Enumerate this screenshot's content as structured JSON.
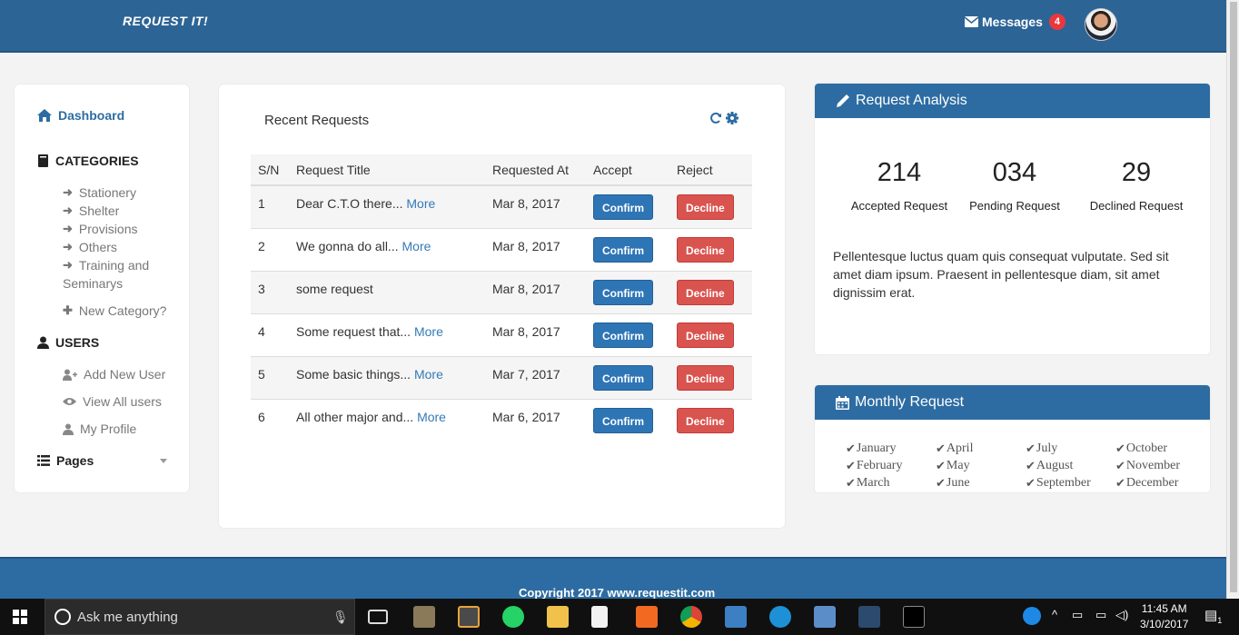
{
  "header": {
    "brand": "REQUEST IT!",
    "messages_label": "Messages",
    "messages_count": "4"
  },
  "sidebar": {
    "dashboard": "Dashboard",
    "categories_title": "CATEGORIES",
    "categories": [
      "Stationery",
      "Shelter",
      "Provisions",
      "Others",
      "Training and",
      "Seminarys"
    ],
    "new_category": "New Category?",
    "users_title": "USERS",
    "add_user": "Add New User",
    "view_users": "View All users",
    "my_profile": "My Profile",
    "pages": "Pages"
  },
  "main": {
    "title": "Recent Requests",
    "columns": [
      "S/N",
      "Request Title",
      "Requested At",
      "Accept",
      "Reject"
    ],
    "confirm_label": "Confirm",
    "decline_label": "Decline",
    "rows": [
      {
        "sn": "1",
        "title": "Dear C.T.O there...",
        "more": "More",
        "date": "Mar 8, 2017"
      },
      {
        "sn": "2",
        "title": "We gonna do all...",
        "more": "More",
        "date": "Mar 8, 2017"
      },
      {
        "sn": "3",
        "title": "some request",
        "more": "",
        "date": "Mar 8, 2017"
      },
      {
        "sn": "4",
        "title": "Some request that...",
        "more": "More",
        "date": "Mar 8, 2017"
      },
      {
        "sn": "5",
        "title": "Some basic things...",
        "more": "More",
        "date": "Mar 7, 2017"
      },
      {
        "sn": "6",
        "title": "All other major and...",
        "more": "More",
        "date": "Mar 6, 2017"
      }
    ]
  },
  "analysis": {
    "title": "Request Analysis",
    "accepted_value": "214",
    "accepted_label": "Accepted Request",
    "pending_value": "034",
    "pending_label": "Pending Request",
    "declined_value": "29",
    "declined_label": "Declined Request",
    "text": "Pellentesque luctus quam quis consequat vulputate. Sed sit amet diam ipsum. Praesent in pellentesque diam, sit amet dignissim erat."
  },
  "monthly": {
    "title": "Monthly Request",
    "months": [
      "January",
      "April",
      "July",
      "October",
      "February",
      "May",
      "August",
      "November",
      "March",
      "June",
      "September",
      "December"
    ]
  },
  "footer": {
    "copyright": "Copyright 2017 www.requestit.com"
  },
  "taskbar": {
    "search_placeholder": "Ask me anything",
    "time": "11:45 AM",
    "date": "3/10/2017",
    "notifications": "1"
  },
  "colors": {
    "header": "#2d6496",
    "primary": "#2d6ca2",
    "confirm": "#2e75b6",
    "decline": "#d9534f",
    "badge": "#e8383d"
  }
}
